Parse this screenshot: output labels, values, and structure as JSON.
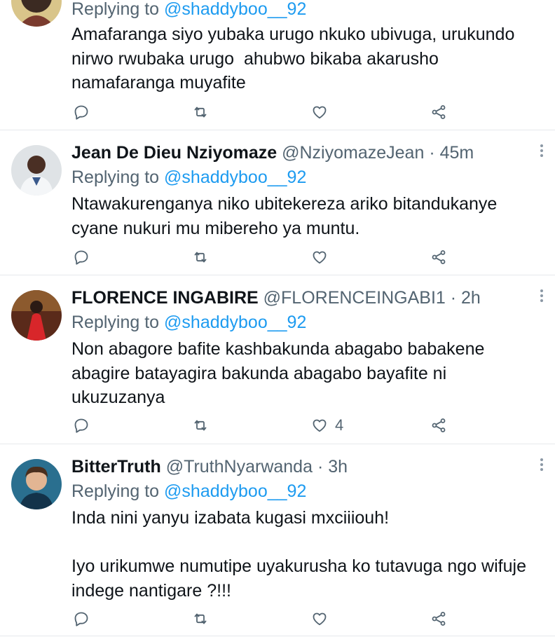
{
  "tweets": [
    {
      "has_header": false,
      "reply_prefix": "Replying to ",
      "reply_mention": "@shaddyboo__92",
      "text": "Amafaranga siyo yubaka urugo nkuko ubivuga, urukundo nirwo rwubaka urugo  ahubwo bikaba akarusho namafaranga muyafite",
      "actions": {
        "reply_icon": "comment-icon",
        "retweet_icon": "retweet-icon",
        "like_icon": "heart-icon",
        "like_count": "",
        "share_icon": "share-icon"
      }
    },
    {
      "has_header": true,
      "name": "Jean De Dieu Nziyomaze",
      "handle": "@NziyomazeJean",
      "dot": "·",
      "time": "45m",
      "reply_prefix": "Replying to ",
      "reply_mention": "@shaddyboo__92",
      "text": "Ntawakurenganya niko ubitekereza ariko bitandukanye cyane nukuri mu mibereho ya muntu.",
      "actions": {
        "reply_icon": "comment-icon",
        "retweet_icon": "retweet-icon",
        "like_icon": "heart-icon",
        "like_count": "",
        "share_icon": "share-icon"
      }
    },
    {
      "has_header": true,
      "name": "FLORENCE INGABIRE",
      "handle": "@FLORENCEINGABI1",
      "dot": "·",
      "time": "2h",
      "reply_prefix": "Replying to ",
      "reply_mention": "@shaddyboo__92",
      "text": "Non abagore bafite kashbakunda abagabo babakene abagire batayagira bakunda abagabo bayafite ni ukuzuzanya",
      "actions": {
        "reply_icon": "comment-icon",
        "retweet_icon": "retweet-icon",
        "like_icon": "heart-icon",
        "like_count": "4",
        "share_icon": "share-icon"
      }
    },
    {
      "has_header": true,
      "name": "BitterTruth",
      "handle": "@TruthNyarwanda",
      "dot": "·",
      "time": "3h",
      "reply_prefix": "Replying to ",
      "reply_mention": "@shaddyboo__92",
      "text": "Inda nini yanyu izabata kugasi mxciiiouh!\n\nIyo urikumwe numutipe uyakurusha ko tutavuga ngo wifuje indege nantigare ?!!!",
      "actions": {
        "reply_icon": "comment-icon",
        "retweet_icon": "retweet-icon",
        "like_icon": "heart-icon",
        "like_count": "",
        "share_icon": "share-icon"
      }
    }
  ]
}
